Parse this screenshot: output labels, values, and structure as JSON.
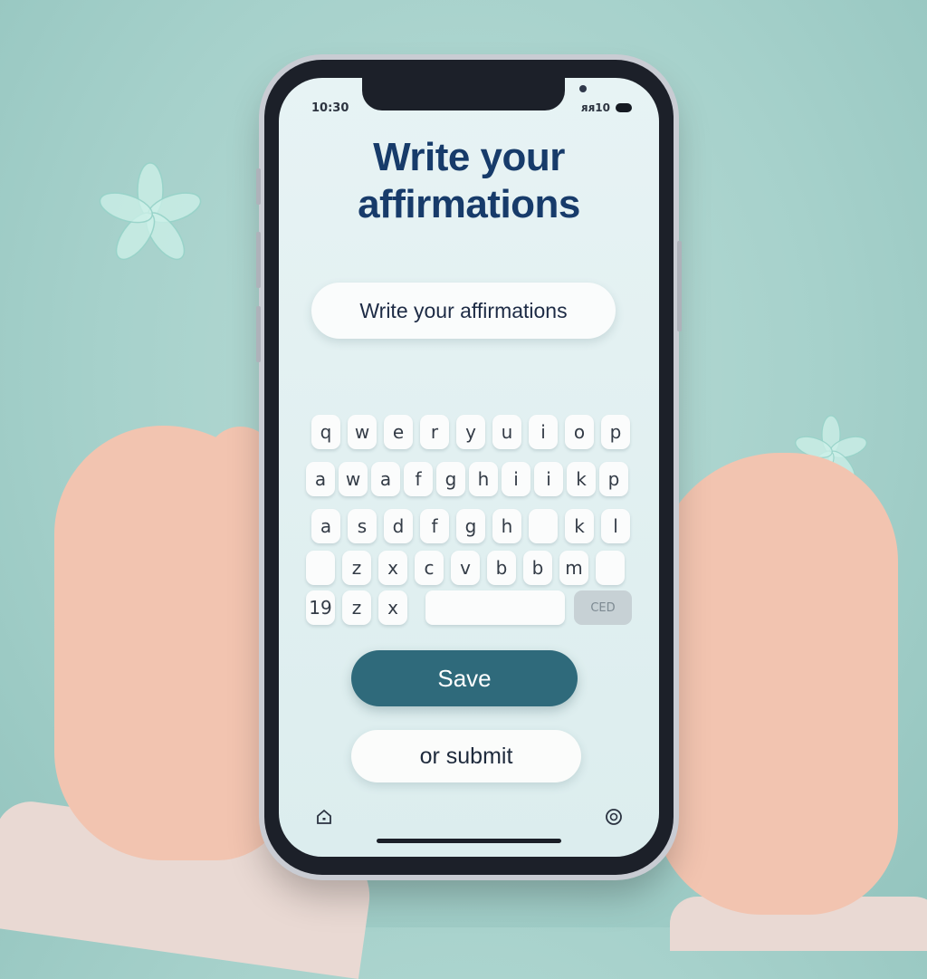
{
  "status_bar": {
    "time": "10:30",
    "right_text": "ᴙᴙ10"
  },
  "screen": {
    "title_line1": "Write your",
    "title_line2": "affirmations",
    "input_text": "Write your affirmations"
  },
  "keyboard": {
    "rows": [
      [
        "q",
        "w",
        "e",
        "r",
        "y",
        "u",
        "i",
        "o",
        "p"
      ],
      [
        "a",
        "w",
        "a",
        "f",
        "g",
        "h",
        "i",
        "i",
        "k",
        "p"
      ],
      [
        "a",
        "s",
        "d",
        "f",
        "g",
        "h",
        "",
        "k",
        "l"
      ],
      [
        "",
        "z",
        "x",
        "c",
        "v",
        "b",
        "b",
        "m",
        ""
      ],
      [
        "19",
        "z",
        "x"
      ]
    ],
    "return_label": "CED"
  },
  "buttons": {
    "save": "Save",
    "submit": "or submit"
  },
  "colors": {
    "save_bg": "#2f6a7b",
    "background": "#a6d1cb",
    "title": "#173b6a"
  }
}
